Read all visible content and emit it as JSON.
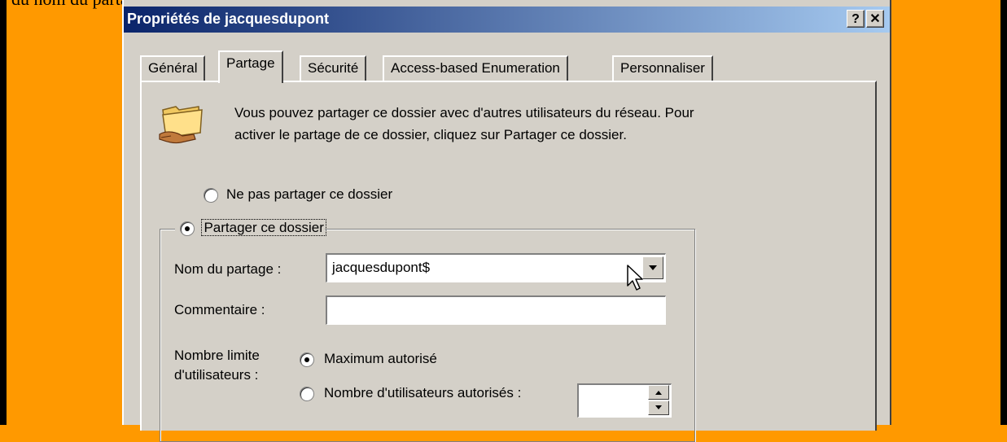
{
  "page": {
    "text_above": "du nom du partage (voir écran ci-dessous)."
  },
  "window": {
    "title": "Propriétés de jacquesdupont",
    "help_label": "?",
    "close_label": "✕"
  },
  "tabs": [
    {
      "label": "Général",
      "active": false
    },
    {
      "label": "Partage",
      "active": true
    },
    {
      "label": "Sécurité",
      "active": false
    },
    {
      "label": "Access-based Enumeration",
      "active": false
    },
    {
      "label": "Personnaliser",
      "active": false
    }
  ],
  "sharing": {
    "info_text": "Vous pouvez partager ce dossier avec d'autres utilisateurs du réseau. Pour activer le partage de ce dossier, cliquez sur Partager ce dossier.",
    "option_no_share": "Ne pas partager ce dossier",
    "option_share": "Partager ce dossier",
    "share_name_label": "Nom du partage :",
    "share_name_value": "jacquesdupont$",
    "comment_label": "Commentaire :",
    "comment_value": "",
    "user_limit_label_line1": "Nombre limite",
    "user_limit_label_line2": "d'utilisateurs :",
    "option_max_allowed": "Maximum autorisé",
    "option_allowed_users": "Nombre d'utilisateurs autorisés :",
    "allowed_users_value": ""
  },
  "icons": {
    "folder": "shared-folder-icon",
    "dropdown": "chevron-down-icon",
    "cursor": "mouse-pointer-icon"
  }
}
